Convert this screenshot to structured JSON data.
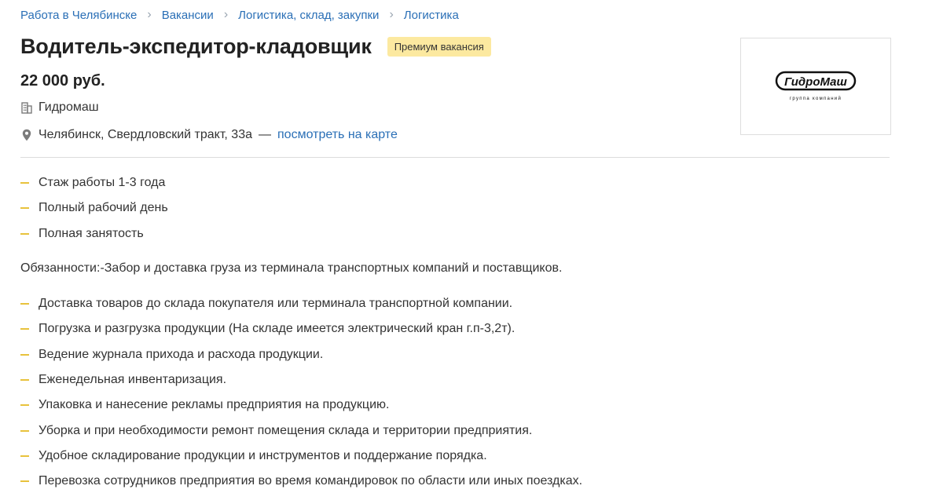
{
  "breadcrumbs": [
    "Работа в Челябинске",
    "Вакансии",
    "Логистика, склад, закупки",
    "Логистика"
  ],
  "vacancy": {
    "title": "Водитель-экспедитор-кладовщик",
    "badge": "Премиум вакансия",
    "salary": "22 000 руб.",
    "company": "Гидромаш",
    "address": "Челябинск, Свердловский тракт, 33а",
    "address_dash": "—",
    "map_link": "посмотреть на карте"
  },
  "logo": {
    "name": "ГидроМаш",
    "tagline": "группа компаний"
  },
  "conditions": [
    "Стаж работы 1-3 года",
    "Полный рабочий день",
    "Полная занятость"
  ],
  "duties_intro": "Обязанности:-Забор и доставка груза из терминала транспортных компаний и поставщиков.",
  "duties": [
    "Доставка товаров до склада покупателя или терминала транспортной компании.",
    "Погрузка и разгрузка продукции (На складе имеется электрический кран г.п-3,2т).",
    "Ведение журнала прихода и расхода продукции.",
    "Еженедельная инвентаризация.",
    "Упаковка и нанесение рекламы предприятия на продукцию.",
    "Уборка и при необходимости ремонт помещения склада и территории предприятия.",
    "Удобное складирование продукции и инструментов и поддержание порядка.",
    "Перевозка сотрудников предприятия во время командировок по области или иных поездках."
  ],
  "colors": {
    "link": "#2a6fb6",
    "badge_bg": "#fce9a0",
    "bullet": "#e8c23c"
  },
  "icons": {
    "company": "building-icon",
    "address": "map-pin-icon",
    "breadcrumb_separator": "chevron-right-icon"
  }
}
